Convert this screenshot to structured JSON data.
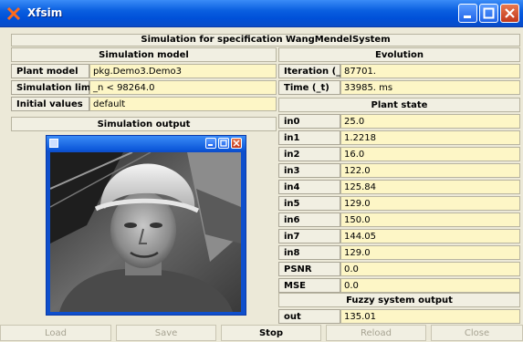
{
  "window": {
    "title": "Xfsim"
  },
  "header": {
    "title": "Simulation for specification WangMendelSystem"
  },
  "simulation_model": {
    "heading": "Simulation model",
    "rows": [
      {
        "label": "Plant model",
        "value": "pkg.Demo3.Demo3"
      },
      {
        "label": "Simulation limit",
        "value": "_n < 98264.0"
      },
      {
        "label": "Initial values",
        "value": "default"
      }
    ]
  },
  "simulation_output": {
    "heading": "Simulation output"
  },
  "evolution": {
    "heading": "Evolution",
    "rows": [
      {
        "label": "Iteration (_n)",
        "value": "87701."
      },
      {
        "label": "Time (_t)",
        "value": "33985. ms"
      }
    ]
  },
  "plant_state": {
    "heading": "Plant state",
    "rows": [
      {
        "label": "in0",
        "value": "25.0"
      },
      {
        "label": "in1",
        "value": "1.2218"
      },
      {
        "label": "in2",
        "value": "16.0"
      },
      {
        "label": "in3",
        "value": "122.0"
      },
      {
        "label": "in4",
        "value": "125.84"
      },
      {
        "label": "in5",
        "value": "129.0"
      },
      {
        "label": "in6",
        "value": "150.0"
      },
      {
        "label": "in7",
        "value": "144.05"
      },
      {
        "label": "in8",
        "value": "129.0"
      },
      {
        "label": "PSNR",
        "value": "0.0"
      },
      {
        "label": "MSE",
        "value": "0.0"
      }
    ]
  },
  "fuzzy_output": {
    "heading": "Fuzzy system output",
    "rows": [
      {
        "label": "out",
        "value": "135.01"
      }
    ]
  },
  "buttons": {
    "load": "Load",
    "save": "Save",
    "stop": "Stop",
    "reload": "Reload",
    "close": "Close"
  },
  "colors": {
    "titlebar": "#0a5fe0",
    "value_bg": "#fdf6c6",
    "panel_bg": "#ece9d8"
  }
}
